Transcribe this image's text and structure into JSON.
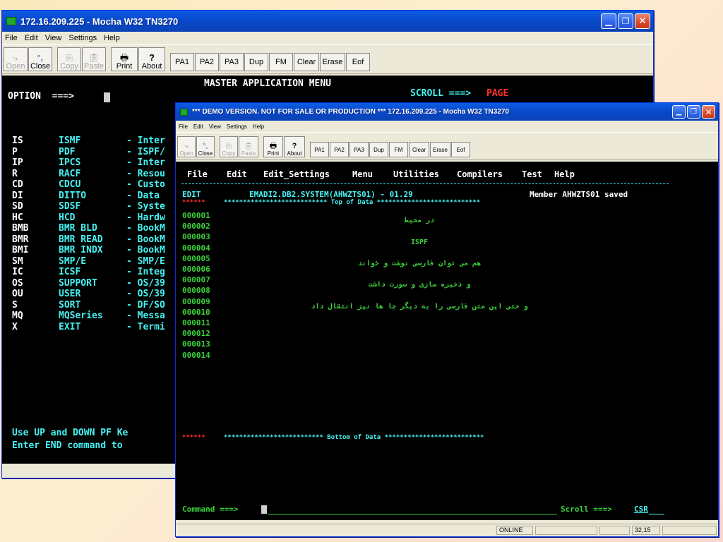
{
  "back_window": {
    "title": "172.16.209.225 - Mocha W32 TN3270",
    "menu": [
      "File",
      "Edit",
      "View",
      "Settings",
      "Help"
    ],
    "toolbar": {
      "open": "Open",
      "close": "Close",
      "copy": "Copy",
      "paste": "Paste",
      "print": "Print",
      "about": "About",
      "keys": [
        "PA1",
        "PA2",
        "PA3",
        "Dup",
        "FM",
        "Clear",
        "Erase",
        "Eof"
      ]
    },
    "terminal": {
      "header": "MASTER APPLICATION MENU",
      "option_label": "OPTION  ===>",
      "scroll_label": "SCROLL ===>",
      "scroll_value": "PAGE",
      "rows": [
        {
          "code": "IS",
          "name": "ISMF",
          "desc": "- Inter"
        },
        {
          "code": "P",
          "name": "PDF",
          "desc": "- ISPF/"
        },
        {
          "code": "IP",
          "name": "IPCS",
          "desc": "- Inter"
        },
        {
          "code": "R",
          "name": "RACF",
          "desc": "- Resou"
        },
        {
          "code": "CD",
          "name": "CDCU",
          "desc": "- Custo"
        },
        {
          "code": "DI",
          "name": "DITTO",
          "desc": "- Data"
        },
        {
          "code": "SD",
          "name": "SDSF",
          "desc": "- Syste"
        },
        {
          "code": "HC",
          "name": "HCD",
          "desc": "- Hardw"
        },
        {
          "code": "BMB",
          "name": "BMR BLD",
          "desc": "- BookM"
        },
        {
          "code": "BMR",
          "name": "BMR READ",
          "desc": "- BookM"
        },
        {
          "code": "BMI",
          "name": "BMR INDX",
          "desc": "- BookM"
        },
        {
          "code": "SM",
          "name": "SMP/E",
          "desc": "- SMP/E"
        },
        {
          "code": "IC",
          "name": "ICSF",
          "desc": "- Integ"
        },
        {
          "code": "OS",
          "name": "SUPPORT",
          "desc": "- OS/39"
        },
        {
          "code": "OU",
          "name": "USER",
          "desc": "- OS/39"
        },
        {
          "code": "S",
          "name": "SORT",
          "desc": "- DF/SO"
        },
        {
          "code": "MQ",
          "name": "MQSeries",
          "desc": "- Messa"
        },
        {
          "code": "X",
          "name": "EXIT",
          "desc": "- Termi"
        }
      ],
      "footer1": "Use UP and DOWN PF Ke",
      "footer2": "Enter END command to"
    }
  },
  "front_window": {
    "title": "*** DEMO VERSION. NOT FOR SALE OR PRODUCTION ***  172.16.209.225 - Mocha W32 TN3270",
    "menu": [
      "File",
      "Edit",
      "View",
      "Settings",
      "Help"
    ],
    "toolbar": {
      "open": "Open",
      "close": "Close",
      "copy": "Copy",
      "paste": "Paste",
      "print": "Print",
      "about": "About",
      "keys": [
        "PA1",
        "PA2",
        "PA3",
        "Dup",
        "FM",
        "Clear",
        "Erase",
        "Eof"
      ]
    },
    "terminal": {
      "ispf_menu": [
        "File",
        "Edit",
        "Edit_Settings",
        "Menu",
        "Utilities",
        "Compilers",
        "Test",
        "Help"
      ],
      "edit_label": "EDIT",
      "dataset": "EMADI2.DB2.SYSTEM(AHWZTS01) - 01.29",
      "member_status": "Member AHWZTS01 saved",
      "top_marker": "******",
      "top_of_data": "*************************** Top of Data ***************************",
      "bottom_of_data": "************************** Bottom of Data **************************",
      "lines": [
        {
          "num": "000001",
          "text": ""
        },
        {
          "num": "000002",
          "text": "در محیط"
        },
        {
          "num": "000003",
          "text": ""
        },
        {
          "num": "000004",
          "text": "ISPF"
        },
        {
          "num": "000005",
          "text": ""
        },
        {
          "num": "000006",
          "text": "هم می توان فارسی نوشت و خواند"
        },
        {
          "num": "000007",
          "text": ""
        },
        {
          "num": "000008",
          "text": "و ذخیره سازی و سورت داشت"
        },
        {
          "num": "000009",
          "text": ""
        },
        {
          "num": "000010",
          "text": "و حتی این متن فارسی را به دیگر جا ها نیز انتقال داد"
        },
        {
          "num": "000011",
          "text": ""
        },
        {
          "num": "000012",
          "text": ""
        },
        {
          "num": "000013",
          "text": ""
        },
        {
          "num": "000014",
          "text": ""
        }
      ],
      "command_label": "Command ===>",
      "scroll_label": "Scroll ===>",
      "scroll_value": "CSR"
    },
    "status": {
      "online": "ONLINE",
      "cursor": "32,15"
    }
  },
  "colors": {
    "terminal_bg": "#000000",
    "cyan": "#47f2f2",
    "green": "#3dd13d",
    "red": "#ff3030",
    "white": "#ffffff"
  }
}
